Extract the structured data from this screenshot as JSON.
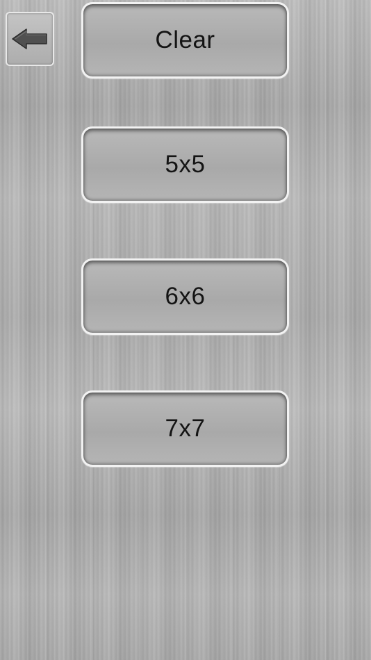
{
  "back": {
    "icon": "arrow-left-icon"
  },
  "buttons": {
    "clear": "Clear",
    "size5": "5x5",
    "size6": "6x6",
    "size7": "7x7"
  },
  "colors": {
    "background": "#b4b4b4",
    "button_border": "#f2f2f2",
    "text": "#141414",
    "arrow_fill": "#505050"
  }
}
